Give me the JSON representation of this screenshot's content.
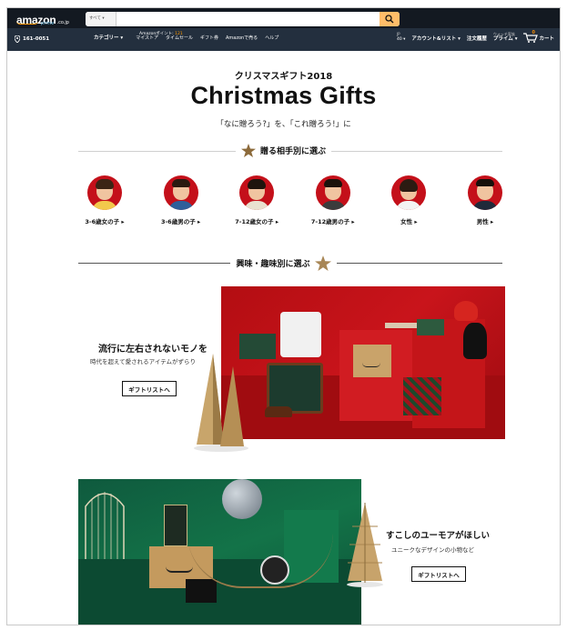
{
  "header": {
    "logo": "amazon",
    "logo_domain": ".co.jp",
    "logo_sub": "prime",
    "search_category": "すべて ▾",
    "search_placeholder": "",
    "location": "161-0051",
    "points_label": "Amazonポイント:",
    "points_value": "121",
    "category_menu": "カテゴリー ▾",
    "links": [
      "マイストア",
      "タイムセール",
      "ギフト券",
      "Amazonで売る",
      "ヘルプ"
    ],
    "language_top": "JP",
    "language_bottom": "40 ▾",
    "account": "アカウント&リスト ▾",
    "orders": "注文履歴",
    "prime_small": "ウォッチ家族",
    "prime": "プライム ▾",
    "cart_count": "0",
    "cart": "カート"
  },
  "hero": {
    "eyebrow": "クリスマスギフト2018",
    "title": "Christmas Gifts",
    "tagline": "「なに贈ろう?」を、「これ贈ろう!」に"
  },
  "section_recipient": {
    "label": "贈る相手別に選ぶ"
  },
  "recipients": [
    {
      "label": "3-6歳女の子",
      "arrow": "▸"
    },
    {
      "label": "3-6歳男の子",
      "arrow": "▸"
    },
    {
      "label": "7-12歳女の子",
      "arrow": "▸"
    },
    {
      "label": "7-12歳男の子",
      "arrow": "▸"
    },
    {
      "label": "女性",
      "arrow": "▸"
    },
    {
      "label": "男性",
      "arrow": "▸"
    }
  ],
  "section_interest": {
    "label": "興味・趣味別に選ぶ"
  },
  "feature1": {
    "title": "流行に左右されないモノを",
    "subtitle": "時代を超えて愛されるアイテムがずらり",
    "button": "ギフトリストへ"
  },
  "feature2": {
    "title": "すこしのユーモアがほしい",
    "subtitle": "ユニークなデザインの小物など",
    "button": "ギフトリストへ"
  },
  "colors": {
    "nav_dark": "#131921",
    "nav": "#232f3e",
    "accent": "#ff9900",
    "feature_red": "#c9141b",
    "feature_green": "#137348"
  }
}
